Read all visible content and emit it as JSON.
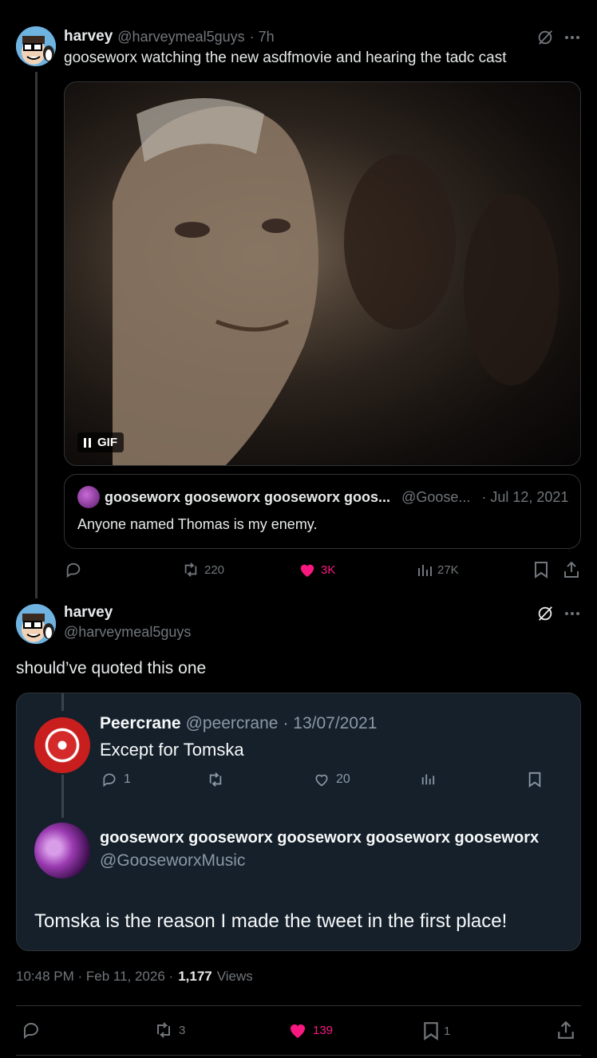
{
  "tweet1": {
    "name": "harvey",
    "handle": "@harveymeal5guys",
    "time": "· 7h",
    "text": "gooseworx watching the new asdfmovie and hearing the tadc cast",
    "media_badge": "GIF",
    "quote": {
      "name": "gooseworx gooseworx gooseworx goos...",
      "handle": "@Goose...",
      "date": "· Jul 12, 2021",
      "text": "Anyone named Thomas is my enemy."
    },
    "stats": {
      "retweets": "220",
      "likes": "3K",
      "views": "27K"
    }
  },
  "tweet2": {
    "name": "harvey",
    "handle": "@harveymeal5guys",
    "text": "should’ve quoted this one",
    "screenshot": {
      "reply": {
        "name": "Peercrane",
        "handle": "@peercrane",
        "date": "· 13/07/2021",
        "text": "Except for Tomska",
        "replies": "1",
        "likes": "20"
      },
      "main": {
        "name": "gooseworx gooseworx gooseworx gooseworx gooseworx",
        "handle": "@GooseworxMusic",
        "text": "Tomska is the reason I made the tweet in the first place!"
      }
    },
    "timestamp": "10:48 PM · Feb 11, 2026 ·",
    "views_count": "1,177",
    "views_label": "Views",
    "stats": {
      "retweets": "3",
      "likes": "139",
      "bookmarks": "1"
    }
  },
  "colors": {
    "like_pink": "#f91880",
    "muted": "#71767b",
    "text": "#e7e9ea"
  }
}
